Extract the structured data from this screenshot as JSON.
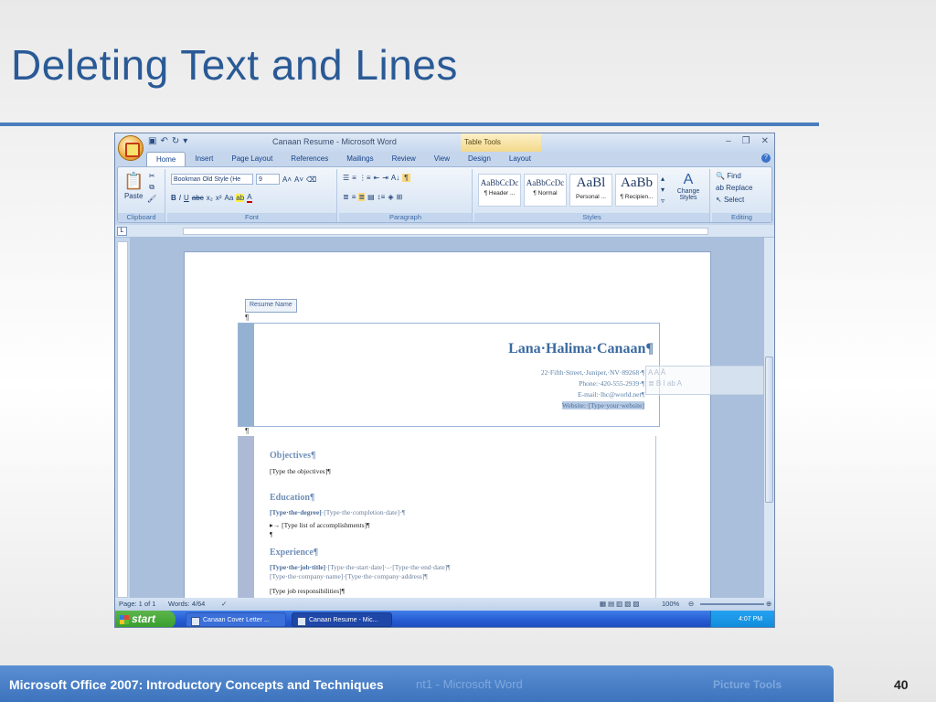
{
  "slide": {
    "title": "Deleting Text and Lines",
    "footer": "Microsoft Office 2007: Introductory Concepts and Techniques",
    "page_number": "40",
    "footer_ghost": "nt1 - Microsoft Word",
    "footer_ghost2": "Picture Tools"
  },
  "word": {
    "window_title": "Canaan Resume - Microsoft Word",
    "context_tab": "Table Tools",
    "tabs": [
      "Home",
      "Insert",
      "Page Layout",
      "References",
      "Mailings",
      "Review",
      "View",
      "Design",
      "Layout"
    ],
    "ribbon": {
      "clipboard": {
        "label": "Clipboard",
        "paste": "Paste"
      },
      "font": {
        "label": "Font",
        "font_name": "Bookman Old Style (He",
        "font_size": "9"
      },
      "paragraph": {
        "label": "Paragraph"
      },
      "styles": {
        "label": "Styles",
        "items": [
          {
            "preview": "AaBbCcDc",
            "name": "¶ Header ..."
          },
          {
            "preview": "AaBbCcDc",
            "name": "¶ Normal"
          },
          {
            "preview": "AaBl",
            "name": "Personal ..."
          },
          {
            "preview": "AaBb",
            "name": "¶ Recipien..."
          }
        ],
        "change_styles": "Change Styles"
      },
      "editing": {
        "label": "Editing",
        "find": "Find",
        "replace": "Replace",
        "select": "Select"
      }
    },
    "document": {
      "content_control_tag": "Resume Name",
      "name": "Lana·Halima·Canaan¶",
      "address": "22·Fifth·Street,·Juniper,·NV·89268·¶",
      "phone": "Phone:·420-555-2939·¶",
      "email": "E-mail:·lhc@world.net¶",
      "website": "Website:·[Type·your·website]",
      "sections": {
        "objectives_heading": "Objectives¶",
        "objectives_text": "[Type the objectives]¶",
        "education_heading": "Education¶",
        "education_degree": "[Type·the·degree]",
        "education_date": "·[Type·the·completion·date]·¶",
        "education_list": "▸→ [Type list of accomplishments]¶",
        "pilcrow": "¶",
        "experience_heading": "Experience¶",
        "experience_title": "[Type·the·job·title]",
        "experience_dates": "·[Type·the·start·date]·–·[Type·the·end·date]¶",
        "experience_company": "[Type·the·company·name]·[Type·the·company·address]¶",
        "experience_resp": "[Type job responsibilities]¶"
      }
    },
    "status": {
      "page": "Page: 1 of 1",
      "words": "Words: 4/64",
      "zoom": "100%"
    },
    "taskbar": {
      "start": "start",
      "task1": "Canaan Cover Letter ...",
      "task2": "Canaan Resume - Mic...",
      "time": "4:07 PM"
    }
  }
}
